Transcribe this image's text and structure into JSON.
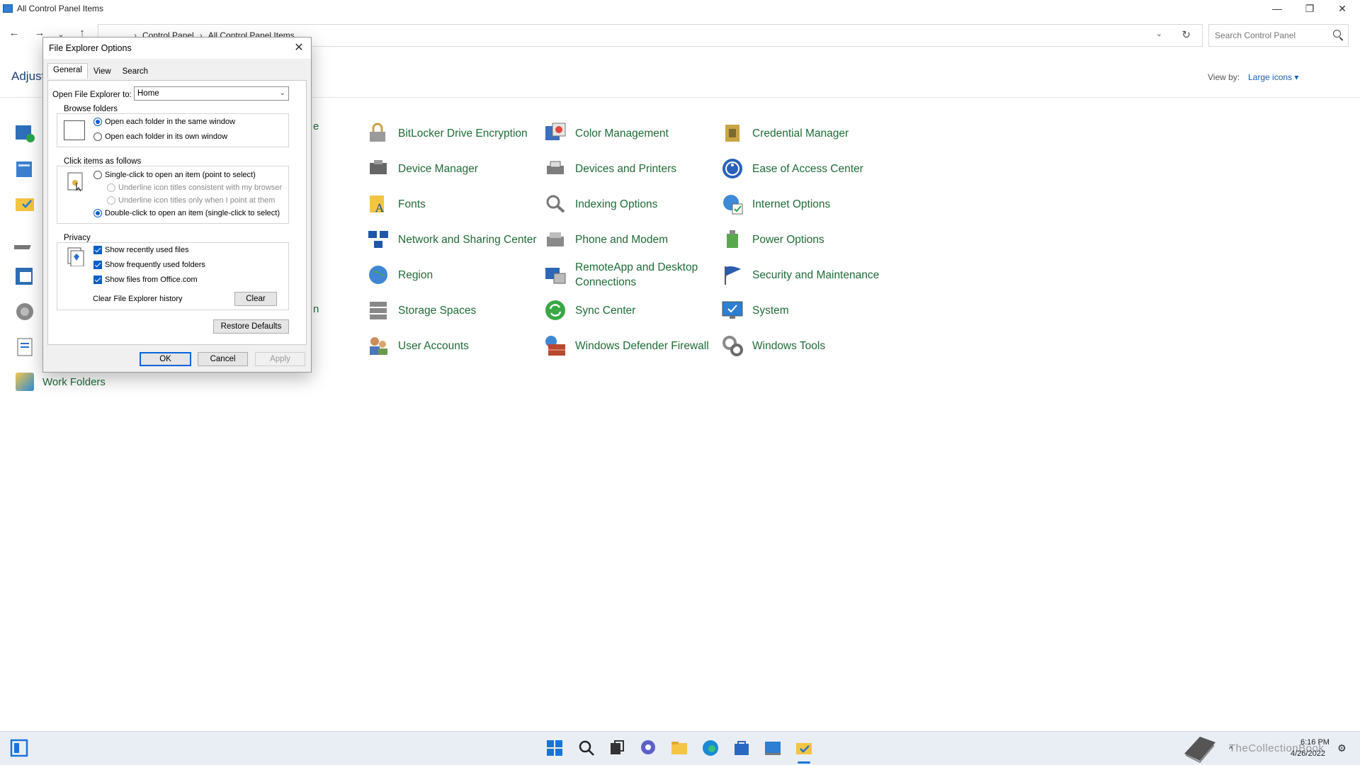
{
  "window": {
    "title": "All Control Panel Items",
    "breadcrumb": [
      "Control Panel",
      "All Control Panel Items"
    ],
    "search_placeholder": "Search Control Panel",
    "adjust_text": "Adjust",
    "view_by_label": "View by:",
    "view_by_value": "Large icons ▾",
    "work_folders": "Work Folders",
    "partial_label_1": "e",
    "partial_label_2": "n"
  },
  "items": [
    {
      "label": "BitLocker Drive Encryption",
      "icon": "bitlocker-icon"
    },
    {
      "label": "Color Management",
      "icon": "color-management-icon"
    },
    {
      "label": "Credential Manager",
      "icon": "credential-manager-icon"
    },
    {
      "label": "Device Manager",
      "icon": "device-manager-icon"
    },
    {
      "label": "Devices and Printers",
      "icon": "printer-icon"
    },
    {
      "label": "Ease of Access Center",
      "icon": "ease-of-access-icon"
    },
    {
      "label": "Fonts",
      "icon": "fonts-icon"
    },
    {
      "label": "Indexing Options",
      "icon": "indexing-icon"
    },
    {
      "label": "Internet Options",
      "icon": "internet-options-icon"
    },
    {
      "label": "Network and Sharing Center",
      "icon": "network-icon"
    },
    {
      "label": "Phone and Modem",
      "icon": "phone-modem-icon"
    },
    {
      "label": "Power Options",
      "icon": "power-options-icon"
    },
    {
      "label": "Region",
      "icon": "region-icon"
    },
    {
      "label": "RemoteApp and Desktop Connections",
      "icon": "remoteapp-icon"
    },
    {
      "label": "Security and Maintenance",
      "icon": "security-flag-icon"
    },
    {
      "label": "Storage Spaces",
      "icon": "storage-spaces-icon"
    },
    {
      "label": "Sync Center",
      "icon": "sync-center-icon"
    },
    {
      "label": "System",
      "icon": "system-monitor-icon"
    },
    {
      "label": "User Accounts",
      "icon": "user-accounts-icon"
    },
    {
      "label": "Windows Defender Firewall",
      "icon": "firewall-icon"
    },
    {
      "label": "Windows Tools",
      "icon": "windows-tools-icon"
    }
  ],
  "dialog": {
    "title": "File Explorer Options",
    "tabs": [
      "General",
      "View",
      "Search"
    ],
    "open_to_label": "Open File Explorer to:",
    "open_to_value": "Home",
    "browse": {
      "legend": "Browse folders",
      "opt1": "Open each folder in the same window",
      "opt2": "Open each folder in its own window"
    },
    "click": {
      "legend": "Click items as follows",
      "opt1": "Single-click to open an item (point to select)",
      "sub1": "Underline icon titles consistent with my browser",
      "sub2": "Underline icon titles only when I point at them",
      "opt2": "Double-click to open an item (single-click to select)"
    },
    "privacy": {
      "legend": "Privacy",
      "chk1": "Show recently used files",
      "chk2": "Show frequently used folders",
      "chk3": "Show files from Office.com",
      "clear_label": "Clear File Explorer history",
      "clear_button": "Clear"
    },
    "restore_defaults": "Restore Defaults",
    "ok": "OK",
    "cancel": "Cancel",
    "apply": "Apply"
  },
  "tray": {
    "time": "6:16 PM",
    "date": "4/26/2022",
    "watermark": "TheCollectionBook"
  },
  "colors": {
    "link_green": "#1e6b37",
    "accent_blue": "#0a5fc4"
  }
}
